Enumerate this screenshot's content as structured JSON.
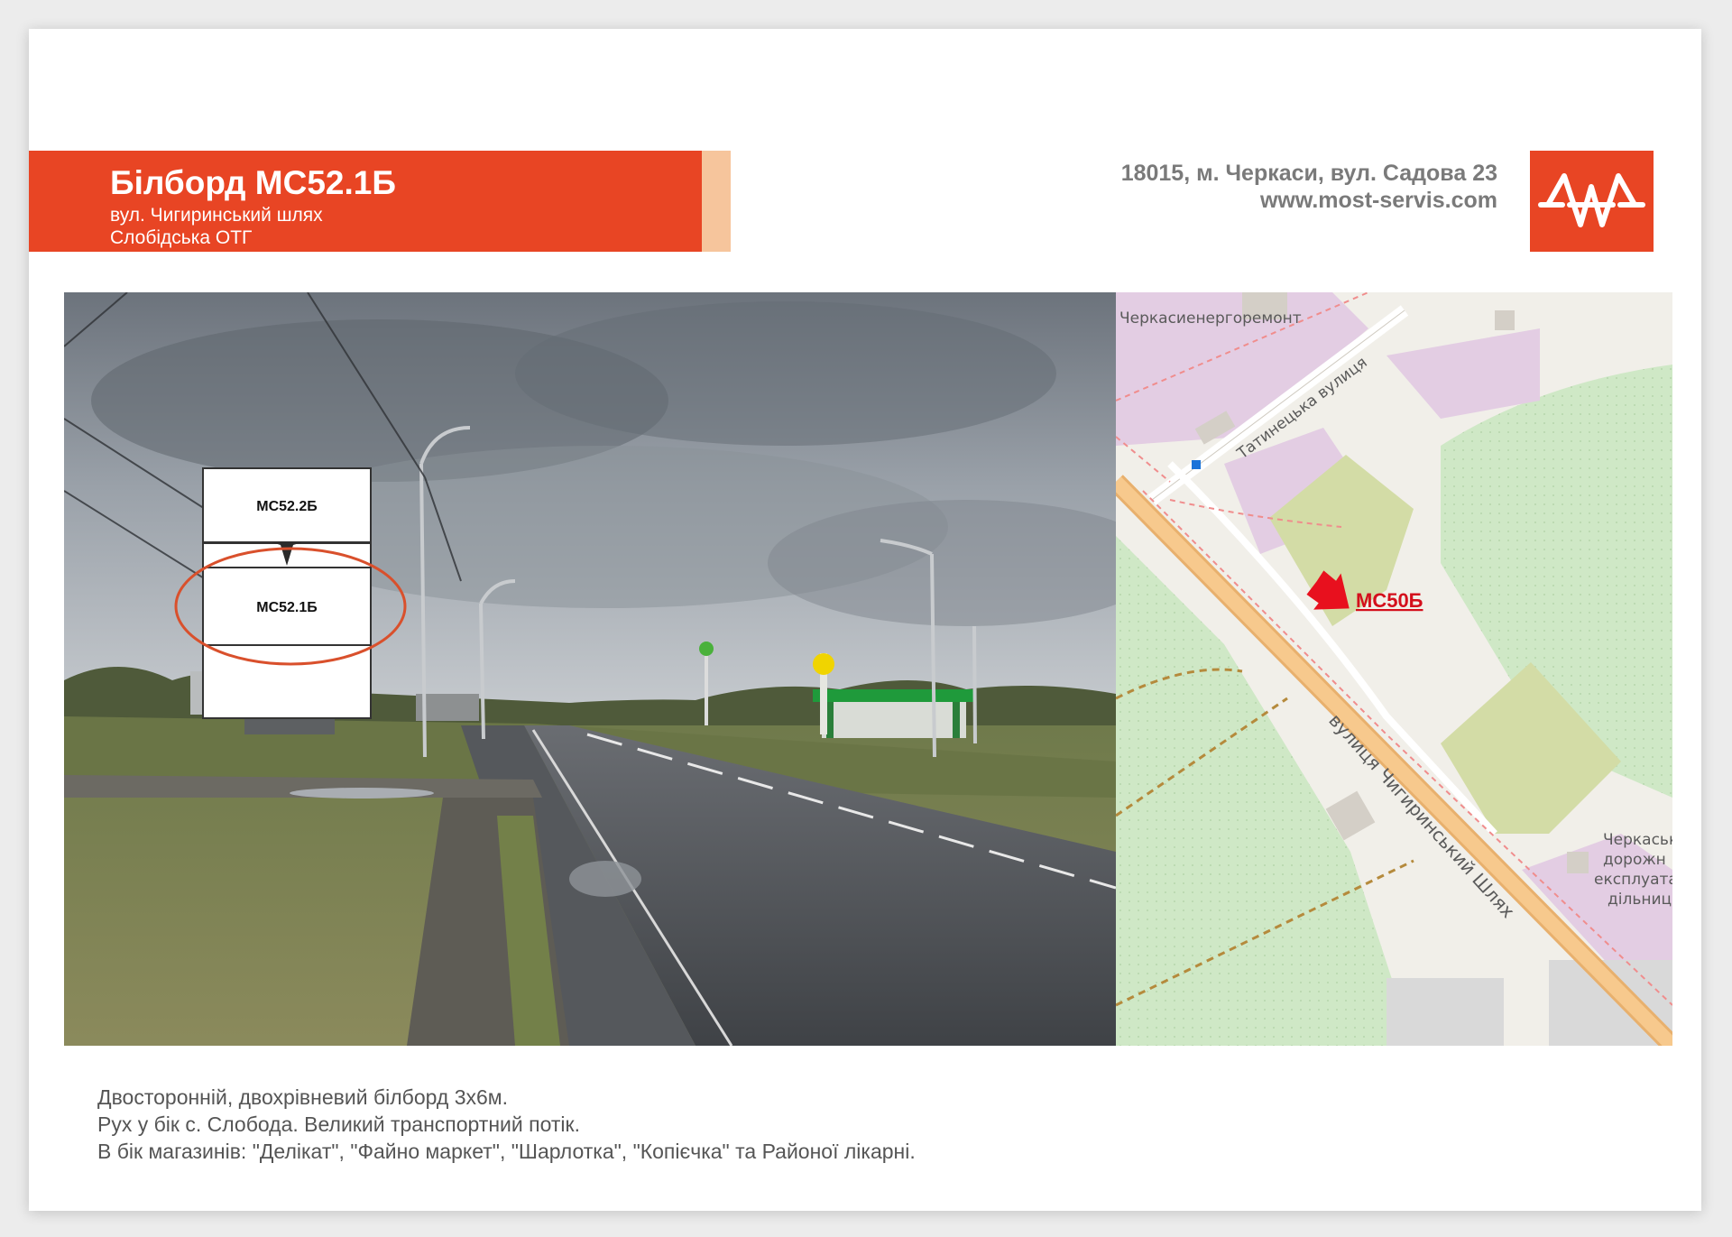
{
  "header": {
    "title": "Білборд МС52.1Б",
    "street": "вул. Чигиринський шлях",
    "community": "Слобідська ОТГ",
    "address": "18015, м. Черкаси, вул. Садова 23",
    "website": "www.most-servis.com"
  },
  "photo": {
    "billboard_upper_label": "МС52.2Б",
    "billboard_lower_label": "МС52.1Б"
  },
  "map": {
    "labels": {
      "org_top": "Черкасиенергоремонт",
      "street_top": "Татинецька вулиця",
      "street_main": "вулиця Чигиринський Шлях",
      "org_right_1": "Черкаськ",
      "org_right_2": "дорожн",
      "org_right_3": "експлуата",
      "org_right_4": "дільниц"
    },
    "marker_label": "МС50Б"
  },
  "description": {
    "line1": "Двосторонній, двохрівневий білборд 3х6м.",
    "line2": "Рух у бік с. Слобода. Великий транспортний потік.",
    "line3": "В бік магазинів: \"Делікат\", \"Файно маркет\", \"Шарлотка\", \"Копієчка\" та Районої лікарні."
  },
  "colors": {
    "brand_orange": "#e84524",
    "accent_peach": "#f6c59c",
    "marker_red": "#e8101e"
  },
  "icons": {
    "logo": "most-servis-logo-icon",
    "marker": "red-arrow-marker-icon"
  }
}
